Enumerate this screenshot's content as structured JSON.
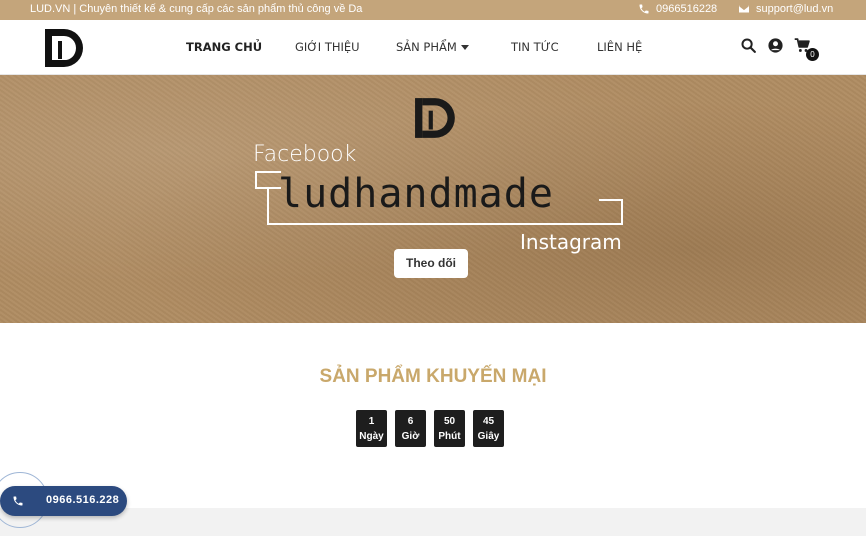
{
  "topbar": {
    "tagline": "LUD.VN | Chuyên thiết kế & cung cấp các sản phẩm thủ công về Da",
    "phone": "0966516228",
    "email": "support@lud.vn"
  },
  "nav": {
    "items": [
      "TRANG CHỦ",
      "GIỚI THIỆU",
      "SẢN PHẨM",
      "TIN TỨC",
      "LIÊN HỆ"
    ],
    "active": "TRANG CHỦ"
  },
  "header": {
    "cart_count": "0"
  },
  "hero": {
    "facebook_label": "Facebook",
    "handle": "ludhandmade",
    "instagram_label": "Instagram",
    "follow_label": "Theo dõi"
  },
  "promo": {
    "title": "SẢN PHẨM KHUYẾN MẠI",
    "countdown": [
      {
        "value": "1",
        "unit": "Ngày"
      },
      {
        "value": "6",
        "unit": "Giờ"
      },
      {
        "value": "50",
        "unit": "Phút"
      },
      {
        "value": "45",
        "unit": "Giây"
      }
    ]
  },
  "call_button": {
    "number": "0966.516.228"
  },
  "colors": {
    "brand_gold": "#c4a57b",
    "promo_title": "#c9a86b",
    "call_blue": "#2c4a7f"
  }
}
